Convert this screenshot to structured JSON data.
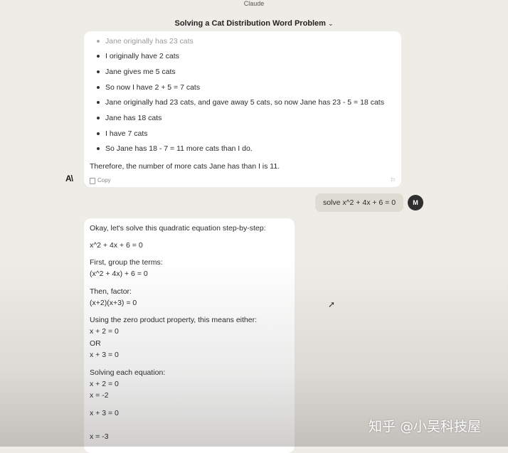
{
  "window": {
    "app_name": "Claude"
  },
  "header": {
    "title": "Solving a Cat Distribution Word Problem",
    "chevron": "⌄"
  },
  "previous_response": {
    "bullets": [
      "Jane originally has 23 cats",
      "I originally have 2 cats",
      "Jane gives me 5 cats",
      "So now I have 2 + 5 = 7 cats",
      "Jane originally had 23 cats, and gave away 5 cats, so now Jane has 23 - 5 = 18 cats",
      "Jane has 18 cats",
      "I have 7 cats",
      "So Jane has 18 - 7 = 11 more cats than I do."
    ],
    "conclusion": "Therefore, the number of more cats Jane has than I is 11.",
    "copy_label": "Copy"
  },
  "assistant_logo": "A\\",
  "user_message": {
    "text": "solve x^2 + 4x + 6 = 0",
    "avatar": "M"
  },
  "response": {
    "lines": [
      "Okay, let's solve this quadratic equation step-by-step:",
      "x^2 + 4x + 6 = 0",
      "First, group the terms:",
      "(x^2 + 4x) + 6 = 0",
      "Then, factor:",
      "(x+2)(x+3) = 0",
      "Using the zero product property, this means either:",
      "x + 2 = 0",
      "OR",
      "x + 3 = 0",
      "Solving each equation:",
      "x + 2 = 0",
      "x = -2",
      "x + 3 = 0",
      "x = -3"
    ]
  },
  "watermark": "知乎 @小吴科技屋"
}
